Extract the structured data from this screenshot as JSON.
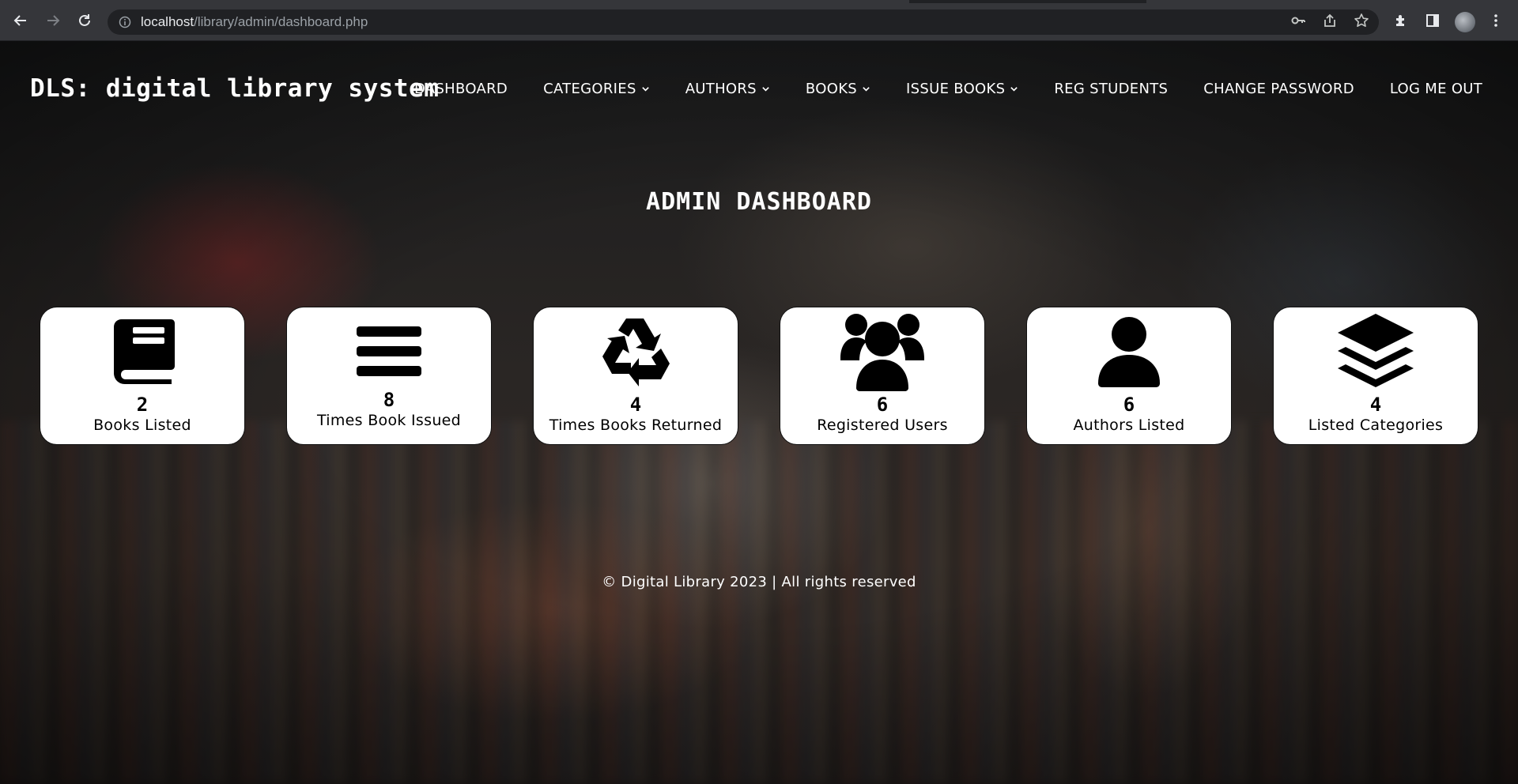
{
  "browser": {
    "url_host": "localhost",
    "url_path": "/library/admin/dashboard.php"
  },
  "brand": {
    "title": "DLS: digital library system"
  },
  "nav": {
    "items": [
      {
        "label": "DASHBOARD",
        "dropdown": false
      },
      {
        "label": "CATEGORIES",
        "dropdown": true
      },
      {
        "label": "AUTHORS",
        "dropdown": true
      },
      {
        "label": "BOOKS",
        "dropdown": true
      },
      {
        "label": "ISSUE BOOKS",
        "dropdown": true
      },
      {
        "label": "REG STUDENTS",
        "dropdown": false
      },
      {
        "label": "CHANGE PASSWORD",
        "dropdown": false
      },
      {
        "label": "LOG ME OUT",
        "dropdown": false
      }
    ]
  },
  "page": {
    "heading": "ADMIN DASHBOARD"
  },
  "stats": [
    {
      "icon": "book-icon",
      "count": "2",
      "label": "Books Listed"
    },
    {
      "icon": "bars-icon",
      "count": "8",
      "label": "Times Book Issued"
    },
    {
      "icon": "recycle-icon",
      "count": "4",
      "label": "Times Books Returned"
    },
    {
      "icon": "users-icon",
      "count": "6",
      "label": "Registered Users"
    },
    {
      "icon": "user-icon",
      "count": "6",
      "label": "Authors Listed"
    },
    {
      "icon": "layers-icon",
      "count": "4",
      "label": "Listed Categories"
    }
  ],
  "footer": {
    "text": "© Digital Library 2023 | All rights reserved"
  }
}
